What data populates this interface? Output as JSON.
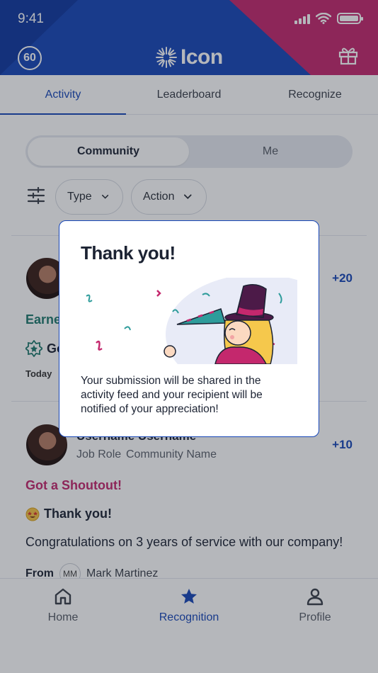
{
  "status": {
    "time": "9:41"
  },
  "header": {
    "points": "60",
    "logo_text": "Icon"
  },
  "tabs": [
    {
      "label": "Activity"
    },
    {
      "label": "Leaderboard"
    },
    {
      "label": "Recognize"
    }
  ],
  "segment": {
    "community": "Community",
    "me": "Me"
  },
  "filters": {
    "type": "Type",
    "action": "Action"
  },
  "posts": [
    {
      "points": "+20",
      "type_label": "Earne",
      "title_fragment": "Go",
      "date": "Today"
    },
    {
      "name": "Username Username",
      "job_role": "Job Role",
      "community": "Community Name",
      "points": "+10",
      "type_label": "Got a Shoutout!",
      "title": "Thank you!",
      "body": "Congratulations on 3 years of service with our company!",
      "from_label": "From",
      "from_initials": "MM",
      "from_name": "Mark Martinez"
    }
  ],
  "nav": [
    {
      "label": "Home",
      "icon": "home-icon"
    },
    {
      "label": "Recognition",
      "icon": "star-icon"
    },
    {
      "label": "Profile",
      "icon": "person-icon"
    }
  ],
  "modal": {
    "title": "Thank you!",
    "message": "Your submission will be shared in the activity feed and your recipient will be notified of your appreciation!"
  },
  "colors": {
    "brand_blue": "#1747b8",
    "brand_pink": "#c4286d",
    "success_green": "#1e7a6d"
  }
}
